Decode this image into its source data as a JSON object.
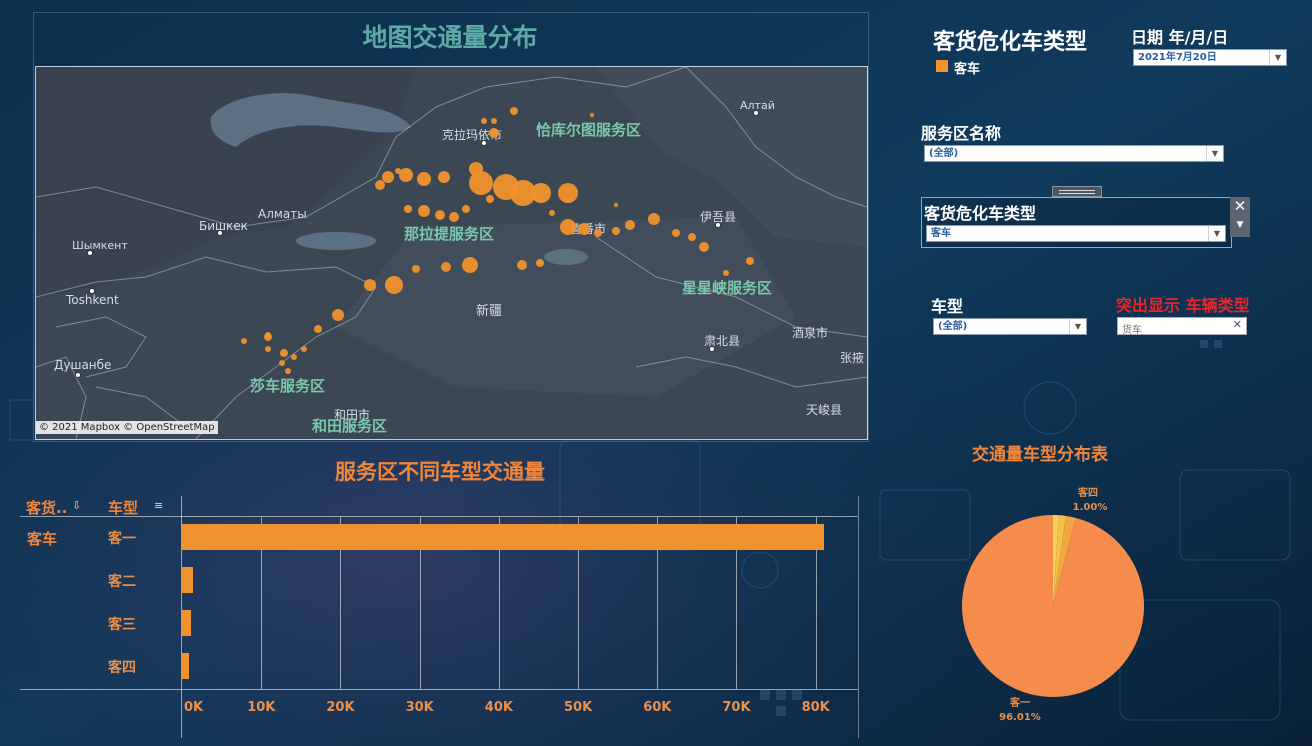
{
  "map": {
    "title": "地图交通量分布",
    "credit": "© 2021 Mapbox © OpenStreetMap",
    "base_labels": [
      "克拉玛依市",
      "Алтай",
      "Бишкек",
      "Алматы",
      "Шымкент",
      "Toshkent",
      "Душанбе",
      "伊吾县",
      "鲁番市",
      "新疆",
      "肃北县",
      "酒泉市",
      "张掖",
      "和田市",
      "天峻县"
    ],
    "service_labels": [
      "恰库尔图服务区",
      "那拉提服务区",
      "星星峡服务区",
      "莎车服务区",
      "和田服务区"
    ]
  },
  "vehicle_category_filter": {
    "title": "客货危化车类型",
    "legend_label": "客车",
    "legend_color": "#f0922d"
  },
  "date_filter": {
    "label": "日期 年/月/日",
    "value": "2021年7月20日"
  },
  "service_area_filter": {
    "label": "服务区名称",
    "value": "(全部)"
  },
  "category_dropdown": {
    "label": "客货危化车类型",
    "value": "客车"
  },
  "vehicle_type_filter": {
    "label": "车型",
    "value": "(全部)"
  },
  "highlight": {
    "label": "突出显示 车辆类型",
    "placeholder": "货车"
  },
  "bar_panel": {
    "title": "服务区不同车型交通量",
    "col_header_1": "客货..",
    "col_header_2": "车型",
    "row_group": "客车"
  },
  "pie_panel": {
    "title": "交通量车型分布表"
  },
  "chart_data": [
    {
      "type": "bar",
      "title": "服务区不同车型交通量",
      "group": "客车",
      "categories": [
        "客一",
        "客二",
        "客三",
        "客四"
      ],
      "values": [
        81000,
        1400,
        1100,
        900
      ],
      "xlim": [
        0,
        85000
      ],
      "xticks": [
        "0K",
        "10K",
        "20K",
        "30K",
        "40K",
        "50K",
        "60K",
        "70K",
        "80K"
      ],
      "grid": true,
      "color": "#f0922d"
    },
    {
      "type": "pie",
      "title": "交通量车型分布表",
      "slices": [
        {
          "label": "客一",
          "value": 96.01,
          "value_label": "96.01%",
          "color": "#f58c4b"
        },
        {
          "label": "客二",
          "value": 1.7,
          "value_label": "",
          "color": "#f4a640"
        },
        {
          "label": "客三",
          "value": 1.29,
          "value_label": "",
          "color": "#f6c14a"
        },
        {
          "label": "客四",
          "value": 1.0,
          "value_label": "1.00%",
          "color": "#f7d35a"
        }
      ]
    }
  ]
}
